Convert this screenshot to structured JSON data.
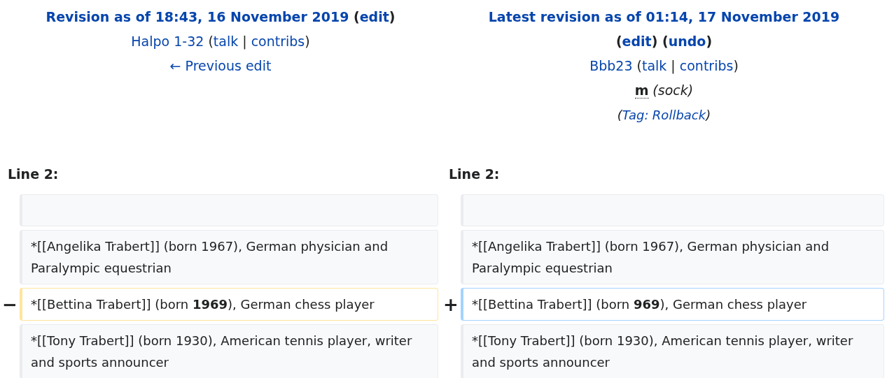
{
  "columns": [
    {
      "header": [
        {
          "kind": "title",
          "parts": [
            {
              "kind": "link",
              "text": "Revision as of 18:43, 16 November 2019"
            },
            {
              "kind": "plain",
              "text": " ("
            },
            {
              "kind": "link",
              "text": "edit"
            },
            {
              "kind": "plain",
              "text": ")"
            }
          ]
        },
        {
          "kind": "user",
          "parts": [
            {
              "kind": "link",
              "text": "Halpo 1-32"
            },
            {
              "kind": "plain",
              "text": " ("
            },
            {
              "kind": "link",
              "text": "talk"
            },
            {
              "kind": "plain",
              "text": " | "
            },
            {
              "kind": "link",
              "text": "contribs"
            },
            {
              "kind": "plain",
              "text": ")"
            }
          ]
        },
        {
          "kind": "nav",
          "parts": [
            {
              "kind": "link",
              "text": "← Previous edit"
            }
          ]
        }
      ],
      "line_label": "Line 2:",
      "rows": [
        {
          "kind": "empty",
          "text": ""
        },
        {
          "kind": "context",
          "text": "*[[Angelika Trabert]] (born 1967), German physician and Paralympic equestrian"
        },
        {
          "kind": "deleted",
          "marker": "−",
          "text": "*[[Bettina Trabert]] (born **1969**), German chess player"
        },
        {
          "kind": "context",
          "text": "*[[Tony Trabert]] (born 1930), American tennis player, writer and sports announcer"
        }
      ]
    },
    {
      "header": [
        {
          "kind": "title",
          "parts": [
            {
              "kind": "link",
              "text": "Latest revision as of 01:14, 17 November 2019"
            }
          ]
        },
        {
          "kind": "actions",
          "parts": [
            {
              "kind": "plain",
              "text": "("
            },
            {
              "kind": "link",
              "text": "edit"
            },
            {
              "kind": "plain",
              "text": ") ("
            },
            {
              "kind": "link",
              "text": "undo"
            },
            {
              "kind": "plain",
              "text": ")"
            }
          ]
        },
        {
          "kind": "user",
          "parts": [
            {
              "kind": "link",
              "text": "Bbb23"
            },
            {
              "kind": "plain",
              "text": " ("
            },
            {
              "kind": "link",
              "text": "talk"
            },
            {
              "kind": "plain",
              "text": " | "
            },
            {
              "kind": "link",
              "text": "contribs"
            },
            {
              "kind": "plain",
              "text": ")"
            }
          ]
        },
        {
          "kind": "summary",
          "parts": [
            {
              "kind": "abbr",
              "text": "m"
            },
            {
              "kind": "comment",
              "text": "(sock)"
            }
          ]
        },
        {
          "kind": "tag",
          "parts": [
            {
              "kind": "plain",
              "text": "("
            },
            {
              "kind": "link",
              "text": "Tag:"
            },
            {
              "kind": "link",
              "text": "Rollback"
            },
            {
              "kind": "plain",
              "text": ")"
            }
          ]
        }
      ],
      "line_label": "Line 2:",
      "rows": [
        {
          "kind": "empty",
          "text": ""
        },
        {
          "kind": "context",
          "text": "*[[Angelika Trabert]] (born 1967), German physician and Paralympic equestrian"
        },
        {
          "kind": "added",
          "marker": "+",
          "text": "*[[Bettina Trabert]] (born **969**), German chess player"
        },
        {
          "kind": "context",
          "text": "*[[Tony Trabert]] (born 1930), American tennis player, writer and sports announcer"
        }
      ]
    }
  ]
}
